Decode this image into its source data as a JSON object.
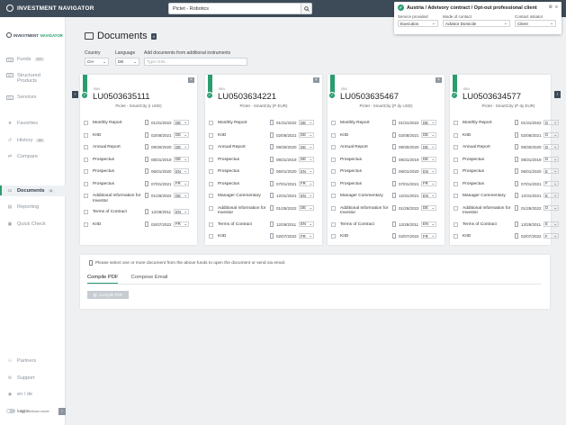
{
  "app": {
    "title": "INVESTMENT NAVIGATOR"
  },
  "search": {
    "value": "Pictet - Robotics"
  },
  "profile": {
    "title": "Austria / Advisory contract / Opt-out professional client",
    "fields": [
      {
        "label": "Service provided",
        "value": "Execution"
      },
      {
        "label": "Mode of contact",
        "value": "Advisor Domicile"
      },
      {
        "label": "Contact initiator",
        "value": "Client"
      }
    ]
  },
  "sidebar": {
    "brand_a": "INVESTMENT ",
    "brand_b": "NAVIGATOR",
    "items": [
      {
        "label": "Funds",
        "abbr": "FD",
        "count": "777"
      },
      {
        "label": "Structured Products",
        "abbr": "SP",
        "count": ""
      },
      {
        "label": "Services",
        "abbr": "SV",
        "count": ""
      },
      {
        "label": "Favorites",
        "icon": "★",
        "count": ""
      },
      {
        "label": "History",
        "icon": "↺",
        "count": "19"
      },
      {
        "label": "Compare",
        "icon": "⇄",
        "count": ""
      },
      {
        "label": "Documents",
        "icon": "▭",
        "count": "4"
      },
      {
        "label": "Reporting",
        "icon": "▤",
        "count": ""
      },
      {
        "label": "Quick Check",
        "icon": "▣",
        "count": ""
      }
    ],
    "bottom": [
      {
        "label": "Partners",
        "icon": "⚇"
      },
      {
        "label": "Support",
        "icon": "⚙"
      },
      {
        "label": "en / de",
        "icon": "◉"
      },
      {
        "label": "Login",
        "icon": "⏻"
      }
    ],
    "high_contrast": "High contrast mode"
  },
  "page": {
    "title": "Documents",
    "count": "4"
  },
  "filters": {
    "country_label": "Country",
    "country_value": "CH",
    "language_label": "Language",
    "language_value": "DE",
    "add_label": "Add documents from additional instruments",
    "add_placeholder": "Type ISIN..."
  },
  "cards": [
    {
      "isin_label": "ISIN",
      "isin": "LU0503635111",
      "fund": "Pictet - SmartCity (I USD)",
      "docs": [
        {
          "name": "Monthly Report",
          "date": "01/31/2022",
          "lang": "DE"
        },
        {
          "name": "KIID",
          "date": "02/08/2021",
          "lang": "DE"
        },
        {
          "name": "Annual Report",
          "date": "09/30/2020",
          "lang": "DE"
        },
        {
          "name": "Prospectus",
          "date": "08/31/2019",
          "lang": "DE"
        },
        {
          "name": "Prospectus",
          "date": "06/01/2020",
          "lang": "EN"
        },
        {
          "name": "Prospectus",
          "date": "07/01/2021",
          "lang": "FR"
        },
        {
          "name": "Additional Information for Investor",
          "date": "01/28/2022",
          "lang": "DE"
        },
        {
          "name": "Terms of Contract",
          "date": "12/28/2011",
          "lang": "EN"
        },
        {
          "name": "KIID",
          "date": "02/07/2022",
          "lang": "FR"
        }
      ]
    },
    {
      "isin_label": "ISIN",
      "isin": "LU0503634221",
      "fund": "Pictet - SmartCity (P EUR)",
      "docs": [
        {
          "name": "Monthly Report",
          "date": "01/31/2022",
          "lang": "DE"
        },
        {
          "name": "KIID",
          "date": "02/08/2021",
          "lang": "DE"
        },
        {
          "name": "Annual Report",
          "date": "09/30/2020",
          "lang": "DE"
        },
        {
          "name": "Prospectus",
          "date": "08/31/2019",
          "lang": "DE"
        },
        {
          "name": "Prospectus",
          "date": "06/01/2020",
          "lang": "EN"
        },
        {
          "name": "Prospectus",
          "date": "07/01/2021",
          "lang": "FR"
        },
        {
          "name": "Manager Commentary",
          "date": "12/31/2021",
          "lang": "EN"
        },
        {
          "name": "Additional Information for Investor",
          "date": "01/28/2022",
          "lang": "DE"
        },
        {
          "name": "Terms of Contract",
          "date": "12/28/2011",
          "lang": "EN"
        },
        {
          "name": "KIID",
          "date": "02/07/2022",
          "lang": "FR"
        }
      ]
    },
    {
      "isin_label": "ISIN",
      "isin": "LU0503635467",
      "fund": "Pictet - SmartCity (P dy USD)",
      "docs": [
        {
          "name": "Monthly Report",
          "date": "01/31/2022",
          "lang": "DE"
        },
        {
          "name": "KIID",
          "date": "02/08/2021",
          "lang": "DE"
        },
        {
          "name": "Annual Report",
          "date": "09/30/2020",
          "lang": "DE"
        },
        {
          "name": "Prospectus",
          "date": "08/31/2019",
          "lang": "DE"
        },
        {
          "name": "Prospectus",
          "date": "06/01/2020",
          "lang": "EN"
        },
        {
          "name": "Prospectus",
          "date": "07/01/2021",
          "lang": "FR"
        },
        {
          "name": "Manager Commentary",
          "date": "12/31/2021",
          "lang": "EN"
        },
        {
          "name": "Additional Information for Investor",
          "date": "01/28/2022",
          "lang": "DE"
        },
        {
          "name": "Terms of Contract",
          "date": "12/28/2011",
          "lang": "EN"
        },
        {
          "name": "KIID",
          "date": "02/07/2022",
          "lang": "FR"
        }
      ]
    },
    {
      "isin_label": "ISIN",
      "isin": "LU0503634577",
      "fund": "Pictet - SmartCity (P dy EUR)",
      "docs": [
        {
          "name": "Monthly Report",
          "date": "01/31/2022",
          "lang": "D"
        },
        {
          "name": "KIID",
          "date": "02/08/2021",
          "lang": "D"
        },
        {
          "name": "Annual Report",
          "date": "09/30/2020",
          "lang": "D"
        },
        {
          "name": "Prospectus",
          "date": "08/31/2019",
          "lang": "D"
        },
        {
          "name": "Prospectus",
          "date": "06/01/2020",
          "lang": "E"
        },
        {
          "name": "Prospectus",
          "date": "07/01/2021",
          "lang": "F"
        },
        {
          "name": "Manager Commentary",
          "date": "12/31/2021",
          "lang": "E"
        },
        {
          "name": "Additional Information for Investor",
          "date": "01/28/2022",
          "lang": "D"
        },
        {
          "name": "Terms of Contract",
          "date": "12/28/2011",
          "lang": "E"
        },
        {
          "name": "KIID",
          "date": "02/07/2022",
          "lang": "F"
        }
      ]
    }
  ],
  "bottom_panel": {
    "hint": "Please select one or more document from the above funds to open the document or send via email.",
    "tabs": [
      "Compile PDF",
      "Compose Email"
    ],
    "button": "Compile PDF"
  },
  "colors": {
    "accent": "#2a9d6f",
    "topbar": "#3d4a57"
  }
}
